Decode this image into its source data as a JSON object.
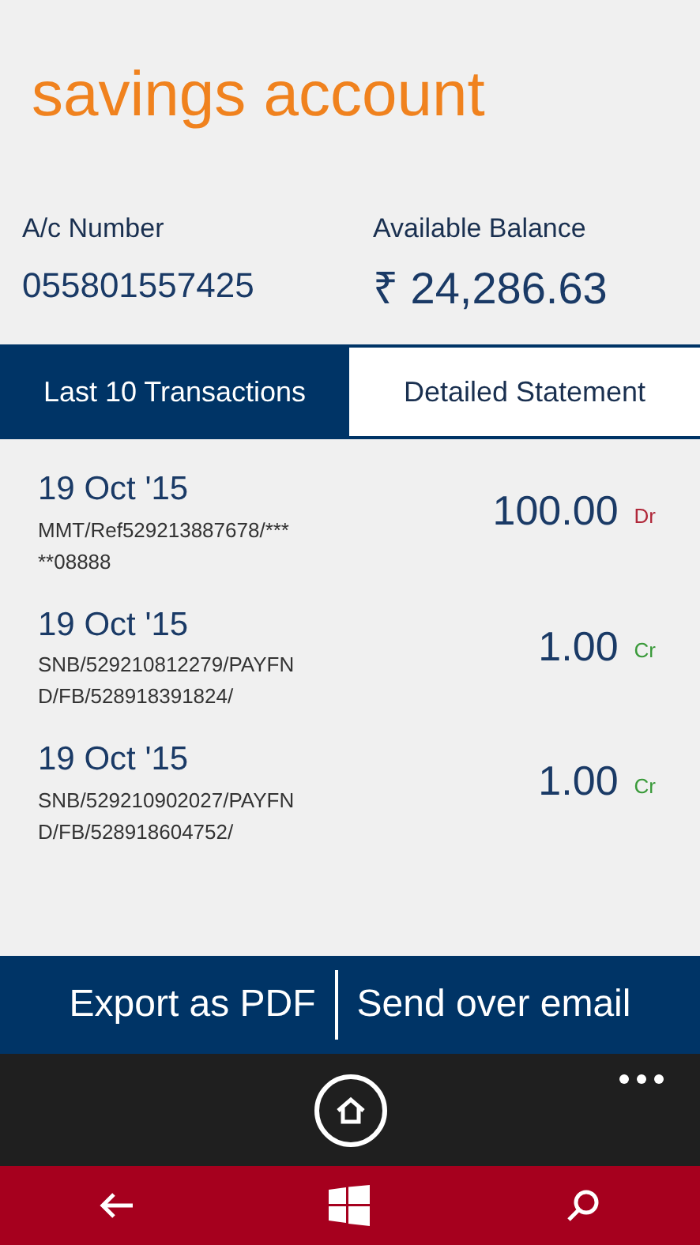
{
  "page_title": "savings account",
  "account": {
    "number_label": "A/c Number",
    "number": "055801557425",
    "balance_label": "Available Balance",
    "balance": "₹ 24,286.63"
  },
  "tabs": [
    {
      "label": "Last 10 Transactions",
      "selected": true
    },
    {
      "label": "Detailed Statement",
      "selected": false
    }
  ],
  "transactions": [
    {
      "date": "19 Oct '15",
      "description_lines": [
        "MMT/Ref529213887678/***",
        "**08888"
      ],
      "amount": "100.00",
      "type": "Dr",
      "kind": "debit"
    },
    {
      "date": "19 Oct '15",
      "description_lines": [
        "SNB/529210812279/PAYFN",
        "D/FB/528918391824/"
      ],
      "amount": "1.00",
      "type": "Cr",
      "kind": "credit"
    },
    {
      "date": "19 Oct '15",
      "description_lines": [
        "SNB/529210902027/PAYFN",
        "D/FB/528918604752/"
      ],
      "amount": "1.00",
      "type": "Cr",
      "kind": "credit"
    }
  ],
  "actions": [
    "Export as PDF",
    "Send over email"
  ]
}
